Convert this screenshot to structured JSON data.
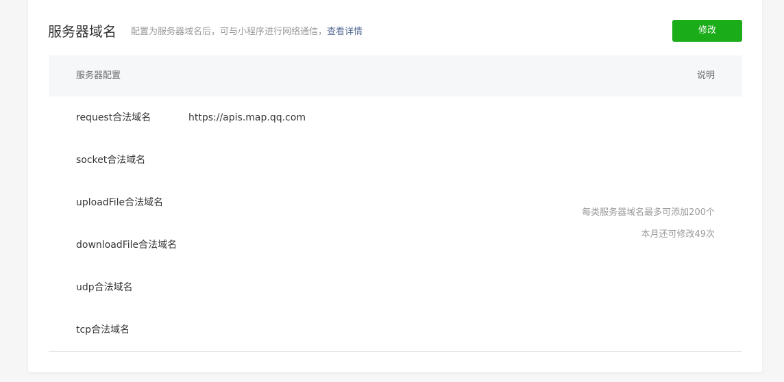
{
  "header": {
    "title": "服务器域名",
    "description": "配置为服务器域名后，可与小程序进行网络通信，",
    "link_label": "查看详情",
    "edit_button": "修改"
  },
  "table": {
    "col_config": "服务器配置",
    "col_desc": "说明",
    "rows": [
      {
        "label": "request合法域名",
        "value": "https://apis.map.qq.com"
      },
      {
        "label": "socket合法域名",
        "value": ""
      },
      {
        "label": "uploadFile合法域名",
        "value": ""
      },
      {
        "label": "downloadFile合法域名",
        "value": ""
      },
      {
        "label": "udp合法域名",
        "value": ""
      },
      {
        "label": "tcp合法域名",
        "value": ""
      }
    ],
    "notes": [
      "每类服务器域名最多可添加200个",
      "本月还可修改49次"
    ]
  },
  "colors": {
    "primary_button": "#1aad19",
    "link": "#576b95",
    "header_bg": "#f6f7f8"
  }
}
